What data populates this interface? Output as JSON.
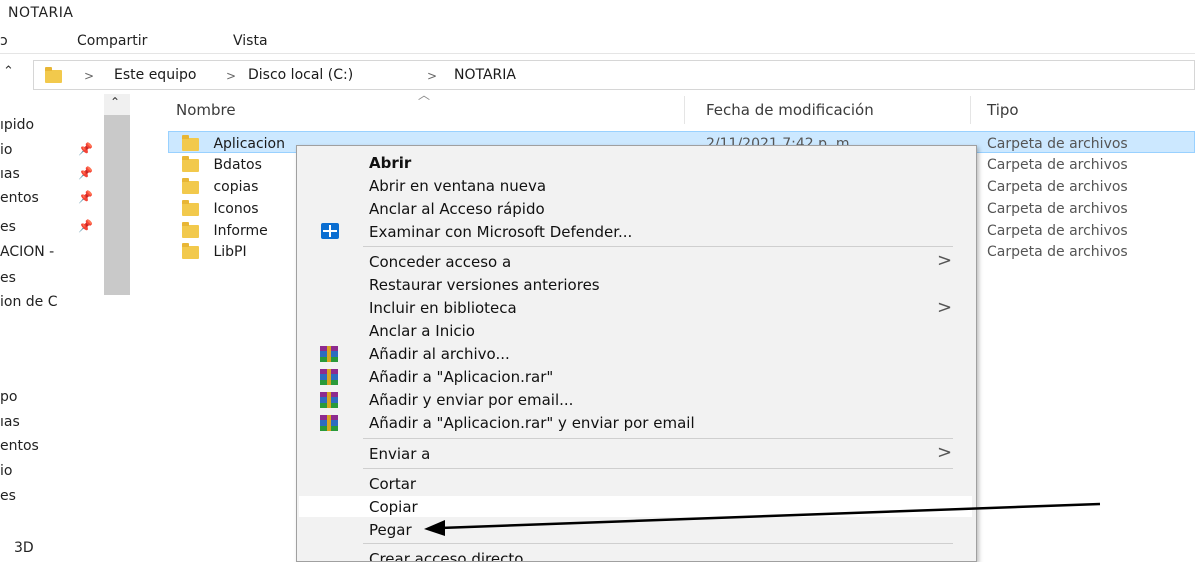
{
  "window": {
    "title": "NOTARIA"
  },
  "ribbon": {
    "tabs": [
      "Compartir",
      "Vista"
    ],
    "left_fragment": "ɔ"
  },
  "address_bar": {
    "chevron": "⌃",
    "segments": [
      "Este equipo",
      "Disco local (C:)",
      "NOTARIA"
    ],
    "separator": ">"
  },
  "nav_pane": {
    "items": [
      {
        "label": "ıpido",
        "pinned": false
      },
      {
        "label": "io",
        "pinned": true
      },
      {
        "label": "ıas",
        "pinned": true
      },
      {
        "label": "entos",
        "pinned": true
      },
      {
        "label": "es",
        "pinned": true
      },
      {
        "label": "ACION -",
        "pinned": false
      },
      {
        "label": "es",
        "pinned": false
      },
      {
        "label": "ion de C",
        "pinned": false
      },
      {
        "label": "po",
        "pinned": false
      },
      {
        "label": "ıas",
        "pinned": false
      },
      {
        "label": "entos",
        "pinned": false
      },
      {
        "label": "io",
        "pinned": false
      },
      {
        "label": "es",
        "pinned": false
      },
      {
        "label": "3D",
        "pinned": false
      }
    ]
  },
  "file_list": {
    "columns": [
      "Nombre",
      "Fecha de modificación",
      "Tipo"
    ],
    "rows": [
      {
        "name": "Aplicacion",
        "date": "2/11/2021 7:42 p. m.",
        "type": "Carpeta de archivos",
        "selected": true
      },
      {
        "name": "Bdatos",
        "date": "",
        "type": "Carpeta de archivos",
        "selected": false
      },
      {
        "name": "copias",
        "date": "",
        "type": "Carpeta de archivos",
        "selected": false
      },
      {
        "name": "Iconos",
        "date": "",
        "type": "Carpeta de archivos",
        "selected": false
      },
      {
        "name": "Informe",
        "date": "",
        "type": "Carpeta de archivos",
        "selected": false
      },
      {
        "name": "LibPI",
        "date": "",
        "type": "Carpeta de archivos",
        "selected": false
      }
    ]
  },
  "context_menu": {
    "items": {
      "abrir": "Abrir",
      "abrir_nueva": "Abrir en ventana nueva",
      "anclar_acceso": "Anclar al Acceso rápido",
      "defender": "Examinar con Microsoft Defender...",
      "conceder": "Conceder acceso a",
      "restaurar": "Restaurar versiones anteriores",
      "incluir": "Incluir en biblioteca",
      "anclar_inicio": "Anclar a Inicio",
      "rar_add": "Añadir al archivo...",
      "rar_add_named": "Añadir a \"Aplicacion.rar\"",
      "rar_email": "Añadir y enviar por email...",
      "rar_named_email": "Añadir a \"Aplicacion.rar\" y enviar por email",
      "enviar": "Enviar a",
      "cortar": "Cortar",
      "copiar": "Copiar",
      "pegar": "Pegar",
      "crear_acceso": "Crear acceso directo"
    },
    "submenu_glyph": ">"
  },
  "colors": {
    "selection_bg": "#cce8ff",
    "selection_border": "#99d1ff",
    "menu_bg": "#f2f2f2",
    "folder": "#f2c94c",
    "annotation_arrow": "#000000"
  }
}
